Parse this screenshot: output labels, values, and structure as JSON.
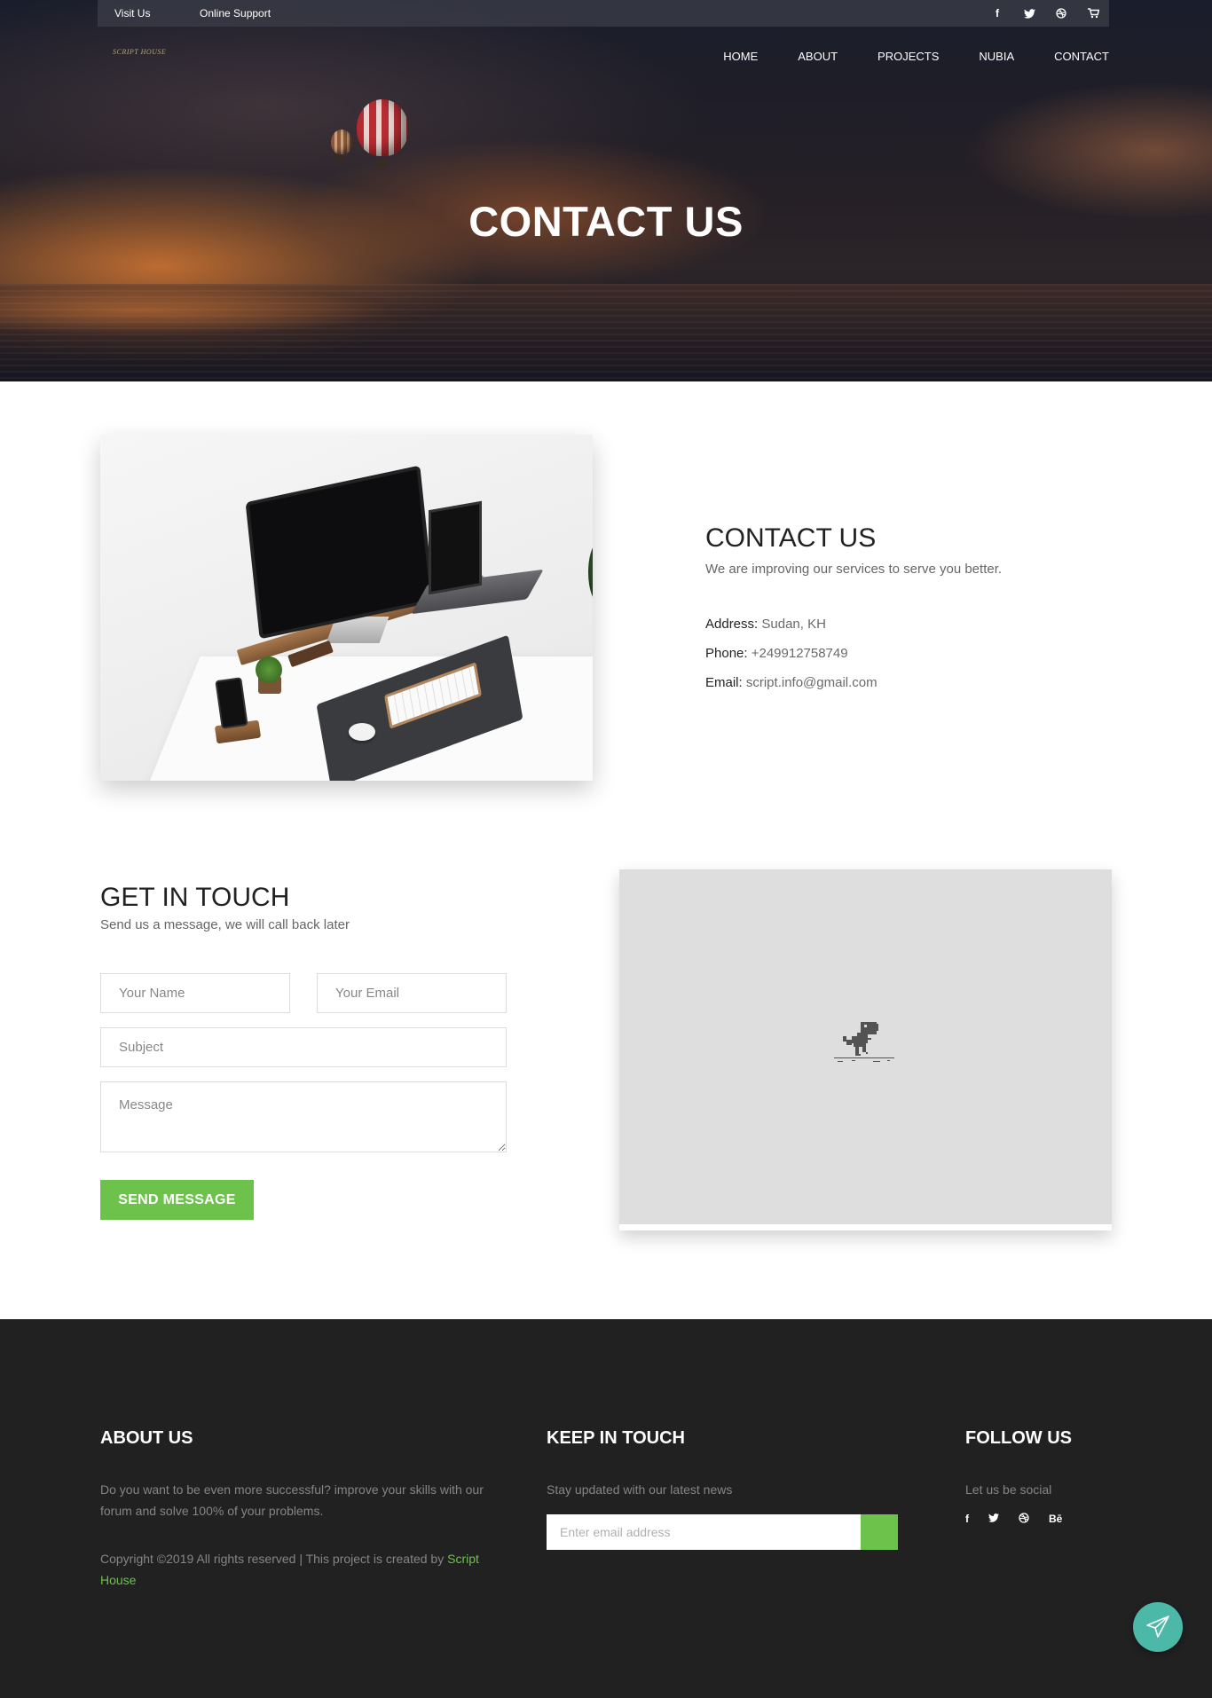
{
  "topbar": {
    "visit_label": "Visit Us",
    "support_label": "Online Support",
    "social_icons": [
      "facebook-icon",
      "twitter-icon",
      "dribbble-icon",
      "cart-icon"
    ]
  },
  "brand": {
    "name": "SCRIPT HOUSE"
  },
  "nav": {
    "items": [
      "HOME",
      "ABOUT",
      "PROJECTS",
      "NUBIA",
      "CONTACT"
    ]
  },
  "hero": {
    "title": "CONTACT US"
  },
  "contact": {
    "heading": "CONTACT US",
    "subtitle": "We are improving our services to serve you better.",
    "address_label": "Address:",
    "address_value": "Sudan, KH",
    "phone_label": "Phone:",
    "phone_value": "+249912758749",
    "email_label": "Email:",
    "email_value": "script.info@gmail.com"
  },
  "form": {
    "heading": "GET IN TOUCH",
    "subtitle": "Send us a message, we will call back later",
    "name_placeholder": "Your Name",
    "email_placeholder": "Your Email",
    "subject_placeholder": "Subject",
    "message_placeholder": "Message",
    "submit_label": "SEND MESSAGE"
  },
  "footer": {
    "about_heading": "ABOUT US",
    "about_text": "Do you want to be even more successful? improve your skills with our forum and solve 100% of your problems.",
    "copyright_text": "Copyright ©2019 All rights reserved | This project is created by ",
    "copyright_link": "Script House",
    "keep_heading": "KEEP IN TOUCH",
    "keep_text": "Stay updated with our latest news",
    "newsletter_placeholder": "Enter email address",
    "follow_heading": "FOLLOW US",
    "follow_text": "Let us be social",
    "social_icons": [
      "facebook-icon",
      "twitter-icon",
      "dribbble-icon",
      "behance-icon"
    ]
  },
  "colors": {
    "accent": "#6cc24a",
    "fab": "#4cb9a8",
    "footer_bg": "#212122"
  }
}
